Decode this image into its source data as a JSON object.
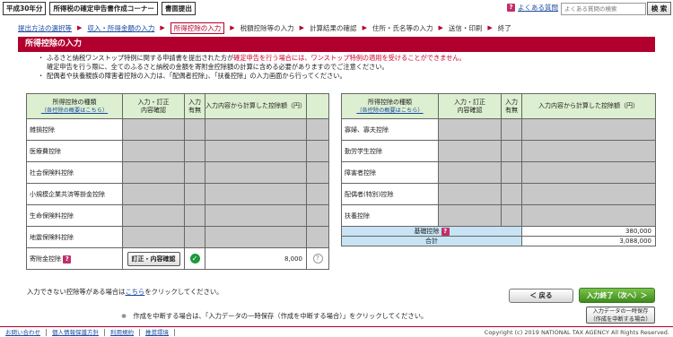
{
  "topbar": {
    "year": "平成30年分",
    "app_title": "所得税の確定申告書作成コーナー",
    "doc_submit": "書面提出",
    "faq": "よくある質問",
    "search_placeholder": "よくある質問の検索",
    "search_button": "検 索"
  },
  "breadcrumb": {
    "steps": [
      "提出方法の選択等",
      "収入・所得金額の入力",
      "所得控除の入力",
      "税額控除等の入力",
      "計算結果の確認",
      "住所・氏名等の入力",
      "送信・印刷",
      "終了"
    ]
  },
  "page_title": "所得控除の入力",
  "notice": {
    "line1a": "ふるさと納税ワンストップ特例に関する申請書を提出された方が",
    "line1b": "確定申告を行う場合には、ワンストップ特例の適用を受けることができません。",
    "line2": "確定申告を行う際に、全てのふるさと納税の金額を寄附金控除額の計算に含める必要がありますのでご注意ください。",
    "line3": "配偶者や扶養親族の障害者控除の入力は、「配偶者控除」、「扶養控除」の入力画面から行ってください。"
  },
  "table_header": {
    "kind": "所得控除の種類",
    "summary_link": "（各控除の概要はこちら）",
    "edit": "入力・訂正\n内容確認",
    "entered": "入力\n有無",
    "amount": "入力内容から計算した控除額（円）"
  },
  "left_rows": [
    {
      "name": "雑損控除"
    },
    {
      "name": "医療費控除"
    },
    {
      "name": "社会保険料控除"
    },
    {
      "name": "小規模企業共済等掛金控除"
    },
    {
      "name": "生命保険料控除"
    },
    {
      "name": "地震保険料控除"
    }
  ],
  "donation_row": {
    "name": "寄附金控除",
    "button": "訂正・内容確認",
    "check": "✓",
    "amount": "8,000",
    "help": "?"
  },
  "right_rows": [
    {
      "name": "寡婦、寡夫控除"
    },
    {
      "name": "勤労学生控除"
    },
    {
      "name": "障害者控除"
    },
    {
      "name": "配偶者(特別)控除"
    },
    {
      "name": "扶養控除"
    }
  ],
  "basic_row": {
    "name": "基礎控除",
    "amount": "380,000"
  },
  "total_row": {
    "name": "合計",
    "amount": "3,088,000"
  },
  "below_note": {
    "before": "入力できない控除等がある場合は",
    "link": "こちら",
    "after": "をクリックしてください。"
  },
  "buttons": {
    "back": "＜ 戻る",
    "next": "入力終了（次へ）＞",
    "save_line1": "入力データの一時保存",
    "save_line2": "（作成を中断する場合）"
  },
  "suspend_note": "※　作成を中断する場合は、「入力データの一時保存（作成を中断する場合）」をクリックしてください。",
  "footer": {
    "links": [
      "お問い合わせ",
      "個人情報保護方針",
      "利用規約",
      "推奨環境"
    ],
    "copyright": "Copyright (c) 2019 NATIONAL TAX AGENCY All Rights Reserved."
  }
}
